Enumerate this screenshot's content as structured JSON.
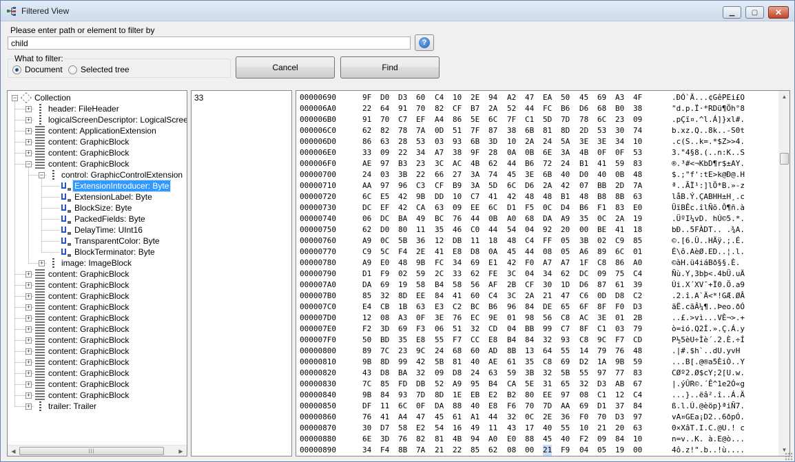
{
  "window": {
    "title": "Filtered View"
  },
  "filter": {
    "prompt": "Please enter path or element to filter by",
    "path_value": "child",
    "help_label": "?",
    "what_to_filter_label": "What to filter:",
    "options": [
      "Document",
      "Selected tree"
    ],
    "selected_option": "Document",
    "cancel_label": "Cancel",
    "find_label": "Find"
  },
  "tree": [
    {
      "depth": 0,
      "label": "Collection",
      "expander": "-",
      "icon": "collection-icon"
    },
    {
      "depth": 1,
      "label": "header: FileHeader",
      "expander": "+",
      "icon": "node-icon"
    },
    {
      "depth": 1,
      "label": "logicalScreenDescriptor: LogicalScreenDe",
      "expander": "+",
      "icon": "node-icon"
    },
    {
      "depth": 1,
      "label": "content: ApplicationExtension",
      "expander": "+",
      "icon": "block-icon"
    },
    {
      "depth": 1,
      "label": "content: GraphicBlock",
      "expander": "+",
      "icon": "block-icon"
    },
    {
      "depth": 1,
      "label": "content: GraphicBlock",
      "expander": "+",
      "icon": "block-icon"
    },
    {
      "depth": 1,
      "label": "content: GraphicBlock",
      "expander": "-",
      "icon": "block-icon"
    },
    {
      "depth": 2,
      "label": "control: GraphicControlExtension",
      "expander": "-",
      "icon": "node-icon"
    },
    {
      "depth": 3,
      "label": "ExtensionIntroducer: Byte",
      "expander": "",
      "icon": "field-icon",
      "selected": true
    },
    {
      "depth": 3,
      "label": "ExtensionLabel: Byte",
      "expander": "",
      "icon": "field-icon"
    },
    {
      "depth": 3,
      "label": "BlockSize: Byte",
      "expander": "",
      "icon": "field-icon"
    },
    {
      "depth": 3,
      "label": "PackedFields: Byte",
      "expander": "",
      "icon": "field-icon"
    },
    {
      "depth": 3,
      "label": "DelayTime: UInt16",
      "expander": "",
      "icon": "field-icon"
    },
    {
      "depth": 3,
      "label": "TransparentColor: Byte",
      "expander": "",
      "icon": "field-icon"
    },
    {
      "depth": 3,
      "label": "BlockTerminator: Byte",
      "expander": "",
      "icon": "field-icon"
    },
    {
      "depth": 2,
      "label": "image: ImageBlock",
      "expander": "+",
      "icon": "node-icon"
    },
    {
      "depth": 1,
      "label": "content: GraphicBlock",
      "expander": "+",
      "icon": "block-icon"
    },
    {
      "depth": 1,
      "label": "content: GraphicBlock",
      "expander": "+",
      "icon": "block-icon"
    },
    {
      "depth": 1,
      "label": "content: GraphicBlock",
      "expander": "+",
      "icon": "block-icon"
    },
    {
      "depth": 1,
      "label": "content: GraphicBlock",
      "expander": "+",
      "icon": "block-icon"
    },
    {
      "depth": 1,
      "label": "content: GraphicBlock",
      "expander": "+",
      "icon": "block-icon"
    },
    {
      "depth": 1,
      "label": "content: GraphicBlock",
      "expander": "+",
      "icon": "block-icon"
    },
    {
      "depth": 1,
      "label": "content: GraphicBlock",
      "expander": "+",
      "icon": "block-icon"
    },
    {
      "depth": 1,
      "label": "content: GraphicBlock",
      "expander": "+",
      "icon": "block-icon"
    },
    {
      "depth": 1,
      "label": "content: GraphicBlock",
      "expander": "+",
      "icon": "block-icon"
    },
    {
      "depth": 1,
      "label": "content: GraphicBlock",
      "expander": "+",
      "icon": "block-icon"
    },
    {
      "depth": 1,
      "label": "content: GraphicBlock",
      "expander": "+",
      "icon": "block-icon"
    },
    {
      "depth": 1,
      "label": "content: GraphicBlock",
      "expander": "+",
      "icon": "block-icon"
    },
    {
      "depth": 1,
      "label": "trailer: Trailer",
      "expander": "+",
      "icon": "node-icon"
    }
  ],
  "offset_value": "33",
  "hex": {
    "rows": [
      {
        "addr": "00000690",
        "bytes": "9F D0 D3 60 C4 10 2E 94 A2 47 EA 50 45 69 A3 4F",
        "ascii": ".ÐÓ`Ä...¢GêPEi£O"
      },
      {
        "addr": "000006A0",
        "bytes": "22 64 91 70 82 CF B7 2A 52 44 FC B6 D6 68 B0 38",
        "ascii": "\"d.p.Ï·*RDü¶Öh°8"
      },
      {
        "addr": "000006B0",
        "bytes": "91 70 C7 EF A4 86 5E 6C 7F C1 5D 7D 78 6C 23 09",
        "ascii": ".pÇï¤.^l.Á]}xl#."
      },
      {
        "addr": "000006C0",
        "bytes": "62 82 78 7A 0D 51 7F 87 38 6B 81 8D 2D 53 30 74",
        "ascii": "b.xz.Q..8k..-S0t"
      },
      {
        "addr": "000006D0",
        "bytes": "86 63 28 53 03 93 6B 3D 10 2A 24 5A 3E 3E 34 10",
        "ascii": ".c(S..k=.*$Z>>4."
      },
      {
        "addr": "000006E0",
        "bytes": "33 09 22 34 A7 38 9F 28 0A 0B 6E 3A 4B 0F 0F 53",
        "ascii": "3.\"4§8.(..n:K..S"
      },
      {
        "addr": "000006F0",
        "bytes": "AE 97 B3 23 3C AC 4B 62 44 B6 72 24 B1 41 59 83",
        "ascii": "®.³#<¬KbD¶r$±AY."
      },
      {
        "addr": "00000700",
        "bytes": "24 03 3B 22 66 27 3A 74 45 3E 6B 40 D0 40 0B 48",
        "ascii": "$.;\"f':tE>k@Ð@.H"
      },
      {
        "addr": "00000710",
        "bytes": "AA 97 96 C3 CF B9 3A 5D 6C D6 2A 42 07 BB 2D 7A",
        "ascii": "ª..ÃÏ¹:]lÖ*B.»-z"
      },
      {
        "addr": "00000720",
        "bytes": "6C E5 42 9B DD 10 C7 41 42 48 48 B1 48 B8 8B 63",
        "ascii": "låB.Ý.ÇABHH±H¸.c"
      },
      {
        "addr": "00000730",
        "bytes": "DC EF 42 CA 63 09 EE 6C D1 F5 0C D4 B6 F1 83 E0",
        "ascii": "ÜïBÊc.îlÑõ.Ô¶ñ.à"
      },
      {
        "addr": "00000740",
        "bytes": "06 DC BA 49 BC 76 44 0B A0 68 DA A9 35 0C 2A 19",
        "ascii": ".ÜºI¼vD. hÚ©5.*."
      },
      {
        "addr": "00000750",
        "bytes": "62 D0 80 11 35 46 C0 44 54 04 92 20 00 BE 41 18",
        "ascii": "bÐ..5FÀDT.. .¾A."
      },
      {
        "addr": "00000760",
        "bytes": "A9 0C 5B 36 12 DB 11 18 48 C4 FF 05 3B 02 C9 85",
        "ascii": "©.[6.Û..HÄÿ.;.É."
      },
      {
        "addr": "00000770",
        "bytes": "C9 5C F4 2E 41 E8 D8 0A 45 44 08 05 A6 89 6C 01",
        "ascii": "É\\ô.AèØ.ED..¦.l."
      },
      {
        "addr": "00000780",
        "bytes": "A9 E0 48 9B FC 34 69 E1 42 F0 A7 A7 1F C8 86 A0",
        "ascii": "©àH.ü4iáBð§§.È. "
      },
      {
        "addr": "00000790",
        "bytes": "D1 F9 02 59 2C 33 62 FE 3C 04 34 62 DC 09 75 C4",
        "ascii": "Ñù.Y,3bþ<.4bÜ.uÄ"
      },
      {
        "addr": "000007A0",
        "bytes": "DA 69 19 58 B4 58 56 AF 2B CF 30 1D D6 87 61 39",
        "ascii": "Úi.X´XV¯+Ï0.Ö.a9"
      },
      {
        "addr": "000007B0",
        "bytes": "85 32 8D EE 84 41 60 C4 3C 2A 21 47 C6 0D D8 C2",
        "ascii": ".2.î.A`Ä<*!GÆ.ØÂ"
      },
      {
        "addr": "000007C0",
        "bytes": "E4 CB 1B 63 E3 C2 BC B6 96 84 DE 65 6F 8F F0 D3",
        "ascii": "äË.cãÂ¼¶..Þeo.ðÓ"
      },
      {
        "addr": "000007D0",
        "bytes": "12 08 A3 0F 3E 76 EC 9E 01 98 56 C8 AC 3E 01 2B",
        "ascii": "..£.>vì...VÈ¬>.+"
      },
      {
        "addr": "000007E0",
        "bytes": "F2 3D 69 F3 06 51 32 CD 04 BB 99 C7 8F C1 03 79",
        "ascii": "ò=ió.Q2Í.».Ç.Á.y"
      },
      {
        "addr": "000007F0",
        "bytes": "50 BD 35 E8 55 F7 CC E8 B4 84 32 93 C8 9C F7 CD",
        "ascii": "P½5èU÷Ìè´.2.È.÷Í"
      },
      {
        "addr": "00000800",
        "bytes": "89 7C 23 9C 24 68 60 AD 8B 13 64 55 14 79 76 48",
        "ascii": ".|#.$h`..dU.yvH"
      },
      {
        "addr": "00000810",
        "bytes": "9B 8D 99 42 5B 81 40 AE 61 35 C8 69 D2 1A 9B 59",
        "ascii": "...B[.@®a5ÈiÒ..Y"
      },
      {
        "addr": "00000820",
        "bytes": "43 D8 BA 32 09 D8 24 63 59 3B 32 5B 55 97 77 83",
        "ascii": "CØº2.Ø$cY;2[U.w."
      },
      {
        "addr": "00000830",
        "bytes": "7C 85 FD DB 52 A9 95 B4 CA 5E 31 65 32 D3 AB 67",
        "ascii": "|.ýÛR©.´Ê^1e2Ó«g"
      },
      {
        "addr": "00000840",
        "bytes": "9B 84 93 7D 8D 1E EB E2 B2 80 EE 97 08 C1 12 C4",
        "ascii": "...}..ëâ².î..Á.Ä"
      },
      {
        "addr": "00000850",
        "bytes": "DF 11 6C 0F DA 88 40 E8 F6 70 7D AA 69 D1 37 84",
        "ascii": "ß.l.Ú.@èöp}ªiÑ7."
      },
      {
        "addr": "00000860",
        "bytes": "76 41 A4 47 45 61 A1 44 32 0C 2E 36 F0 70 D3 97",
        "ascii": "vA¤GEa¡D2..6ðpÓ."
      },
      {
        "addr": "00000870",
        "bytes": "30 D7 58 E2 54 16 49 11 43 17 40 55 10 21 20 63",
        "ascii": "0×XâT.I.C.@U.! c"
      },
      {
        "addr": "00000880",
        "bytes": "6E 3D 76 82 81 4B 94 A0 E0 88 45 40 F2 09 84 10",
        "ascii": "n=v..K. à.E@ò..."
      },
      {
        "addr": "00000890",
        "bytes": "34 F4 8B 7A 21 22 85 62 08 00 21 F9 04 05 19 00",
        "ascii": "4ô.z!\".b..!ù....",
        "highlight_index": 10
      }
    ]
  }
}
